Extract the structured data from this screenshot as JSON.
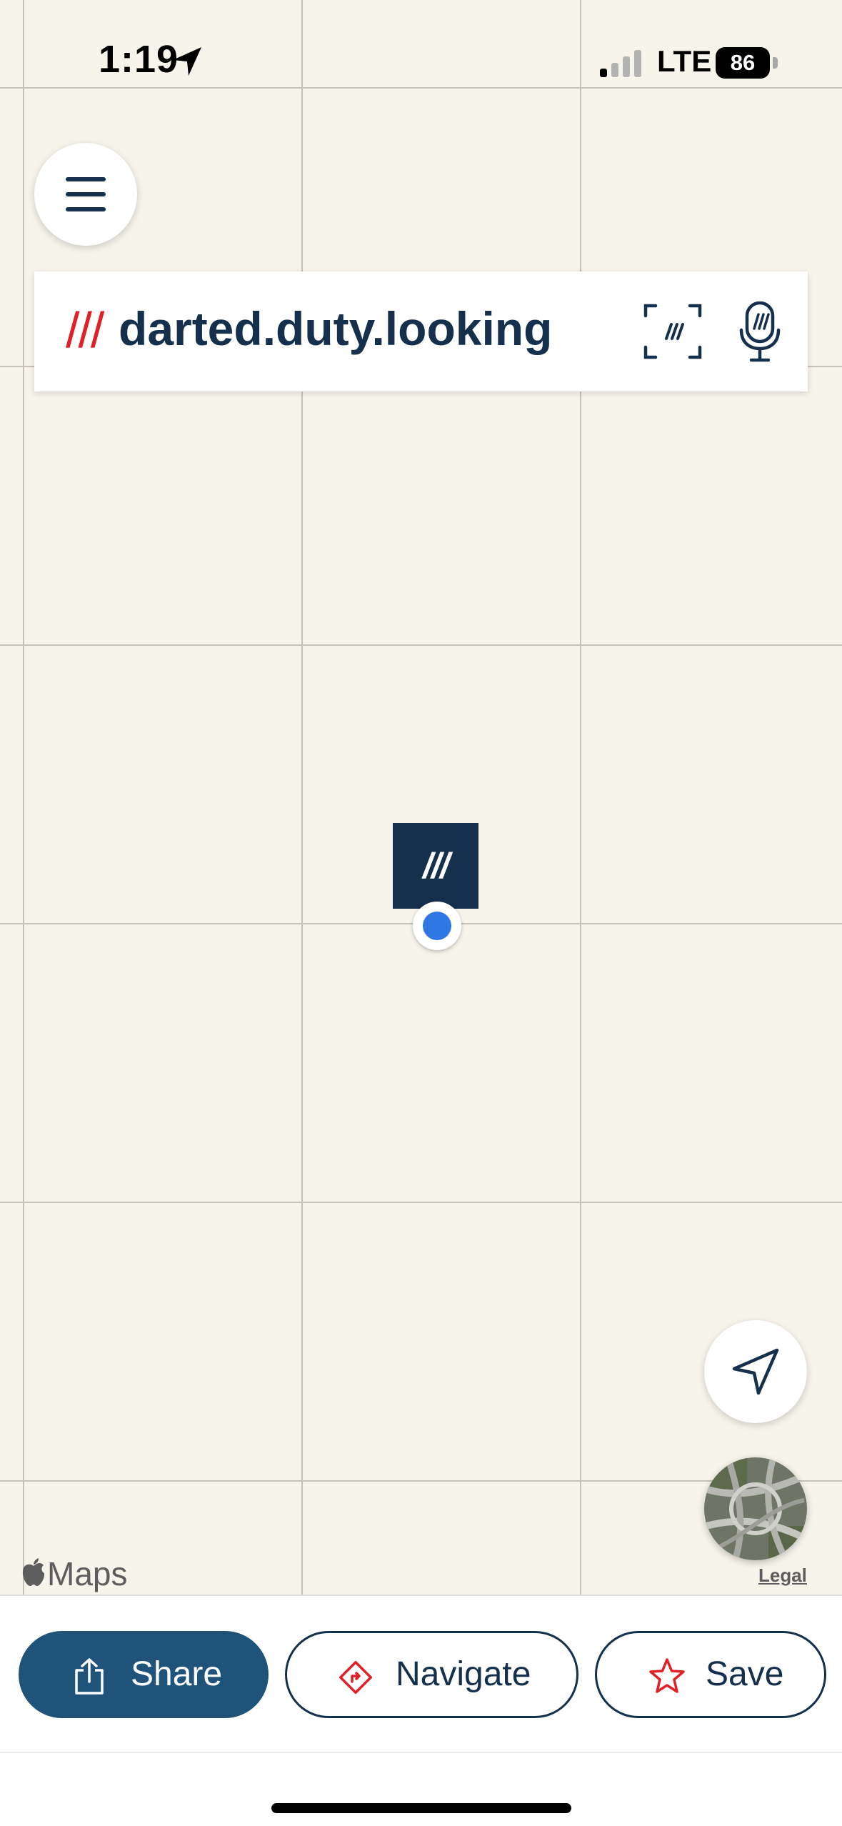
{
  "status_bar": {
    "time": "1:19",
    "network": "LTE",
    "battery": "86",
    "icons": [
      "location-arrow-icon",
      "signal-icon",
      "battery-icon"
    ]
  },
  "menu": {
    "icon": "hamburger-menu-icon"
  },
  "search": {
    "prefix": "///",
    "address": "darted.duty.looking",
    "scan_icon": "scan-icon",
    "mic_icon": "microphone-icon"
  },
  "map": {
    "pin_label": "///",
    "current_location_icon": "current-location-dot",
    "locate_icon": "navigation-arrow-icon",
    "satellite_thumbnail": "satellite-view-thumbnail",
    "attribution": "Maps",
    "legal": "Legal"
  },
  "actions": {
    "share": "Share",
    "navigate": "Navigate",
    "save": "Save",
    "share_icon": "share-icon",
    "navigate_icon": "directions-icon",
    "save_icon": "star-icon"
  },
  "colors": {
    "map_background": "#f7f4ec",
    "grid_line": "#c7c2b7",
    "brand_navy": "#14304d",
    "share_button": "#1f5379",
    "brand_red": "#e11f26",
    "location_blue": "#2f78e3"
  }
}
